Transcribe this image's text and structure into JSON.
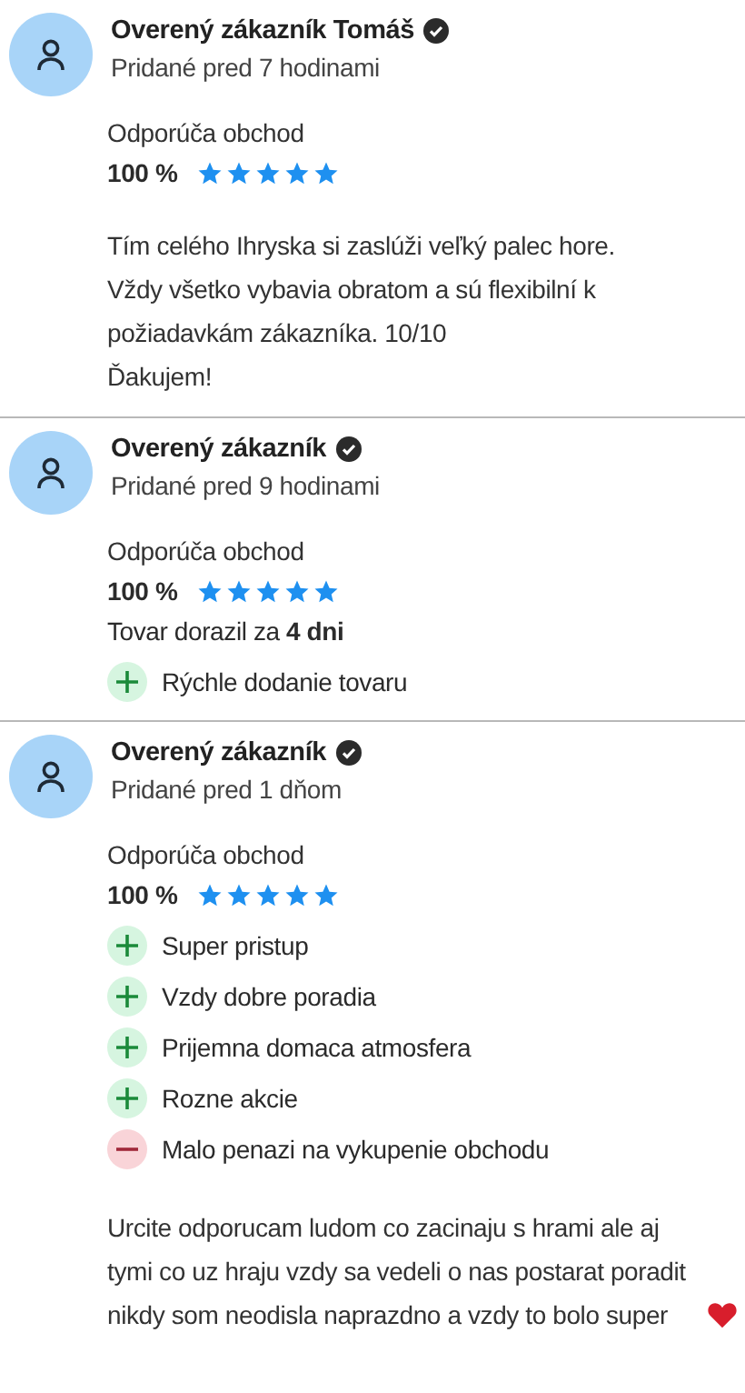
{
  "reviews": [
    {
      "author": "Overený zákazník Tomáš",
      "verified": true,
      "added": "Pridané pred 7 hodinami",
      "recommend_label": "Odporúča obchod",
      "percent": "100 %",
      "stars": 5,
      "text": "Tím celého Ihryska si zaslúži veľký palec hore.\nVždy všetko vybavia obratom a sú flexibilní k požiadavkám zákazníka. 10/10\nĎakujem!"
    },
    {
      "author": "Overený zákazník",
      "verified": true,
      "added": "Pridané pred 9 hodinami",
      "recommend_label": "Odporúča obchod",
      "percent": "100 %",
      "stars": 5,
      "delivery": "Tovar dorazil za **4 dni**",
      "points": [
        {
          "kind": "pro",
          "text": "Rýchle dodanie tovaru"
        }
      ]
    },
    {
      "author": "Overený zákazník",
      "verified": true,
      "added": "Pridané pred 1 dňom",
      "recommend_label": "Odporúča obchod",
      "percent": "100 %",
      "stars": 5,
      "points": [
        {
          "kind": "pro",
          "text": "Super pristup"
        },
        {
          "kind": "pro",
          "text": "Vzdy dobre poradia"
        },
        {
          "kind": "pro",
          "text": "Prijemna domaca atmosfera"
        },
        {
          "kind": "pro",
          "text": "Rozne akcie"
        },
        {
          "kind": "con",
          "text": "Malo penazi na vykupenie obchodu"
        }
      ],
      "text": "Urcite odporucam ludom co zacinaju s hrami ale aj tymi co uz hraju vzdy sa vedeli o nas postarat poradit nikdy som neodisla naprazdno a vzdy to bolo super",
      "text_heart": true
    }
  ]
}
